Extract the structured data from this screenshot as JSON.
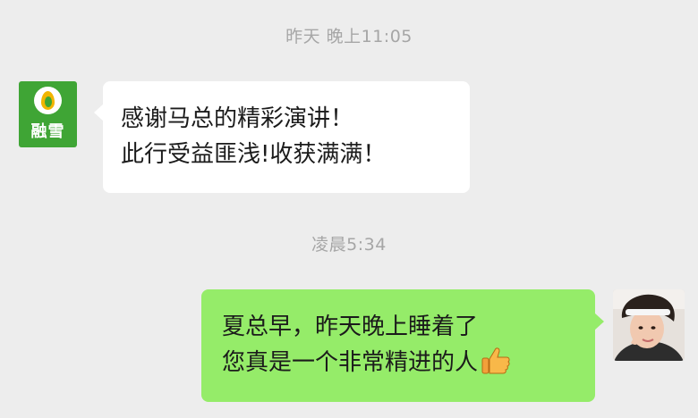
{
  "chat": {
    "timestamp_1": "昨天 晚上11:05",
    "timestamp_2": "凌晨5:34",
    "incoming": {
      "avatar_text": "融雪",
      "avatar_icon": "droplet-leaf-logo",
      "lines": [
        "感谢马总的精彩演讲！",
        "此行受益匪浅!收获满满！"
      ]
    },
    "outgoing": {
      "avatar_icon": "user-photo-avatar",
      "lines": [
        "夏总早，昨天晚上睡着了",
        "您真是一个非常精进的人"
      ],
      "emoji": "thumbs-up-icon"
    }
  },
  "colors": {
    "background": "#ededed",
    "incoming_bubble": "#ffffff",
    "outgoing_bubble": "#95ec69",
    "timestamp": "#a6a6a6",
    "brand_green": "#3fa535"
  }
}
